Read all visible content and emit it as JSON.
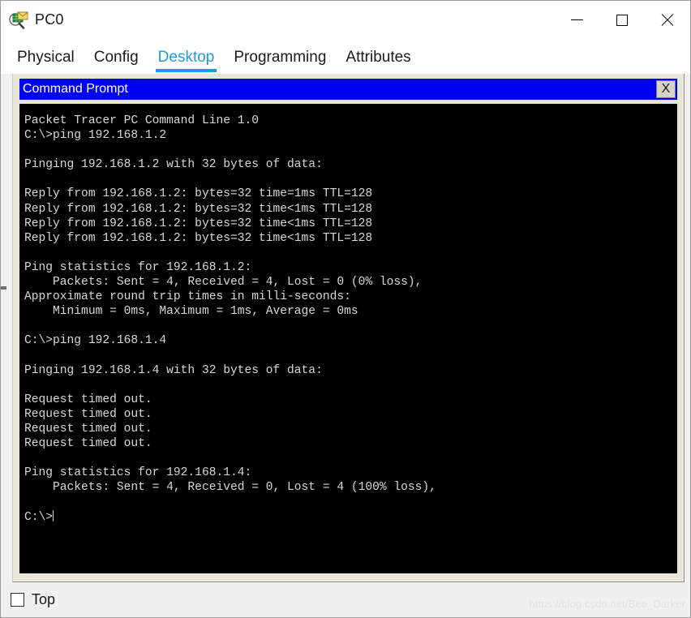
{
  "window": {
    "title": "PC0",
    "icon": "pc-magnifier-envelope-icon",
    "controls": {
      "minimize": "minimize-icon",
      "maximize": "maximize-icon",
      "close": "close-icon"
    }
  },
  "tabs": [
    {
      "label": "Physical",
      "active": false
    },
    {
      "label": "Config",
      "active": false
    },
    {
      "label": "Desktop",
      "active": true
    },
    {
      "label": "Programming",
      "active": false
    },
    {
      "label": "Attributes",
      "active": false
    }
  ],
  "colors": {
    "accent": "#1e9bd7",
    "cmd_titlebar": "#0000f0",
    "panel": "#e8e6d6",
    "terminal_bg": "#000000",
    "terminal_fg": "#d8d8d8"
  },
  "command_prompt": {
    "title": "Command Prompt",
    "close_label": "X",
    "lines": [
      "Packet Tracer PC Command Line 1.0",
      "C:\\>ping 192.168.1.2",
      "",
      "Pinging 192.168.1.2 with 32 bytes of data:",
      "",
      "Reply from 192.168.1.2: bytes=32 time=1ms TTL=128",
      "Reply from 192.168.1.2: bytes=32 time<1ms TTL=128",
      "Reply from 192.168.1.2: bytes=32 time<1ms TTL=128",
      "Reply from 192.168.1.2: bytes=32 time<1ms TTL=128",
      "",
      "Ping statistics for 192.168.1.2:",
      "    Packets: Sent = 4, Received = 4, Lost = 0 (0% loss),",
      "Approximate round trip times in milli-seconds:",
      "    Minimum = 0ms, Maximum = 1ms, Average = 0ms",
      "",
      "C:\\>ping 192.168.1.4",
      "",
      "Pinging 192.168.1.4 with 32 bytes of data:",
      "",
      "Request timed out.",
      "Request timed out.",
      "Request timed out.",
      "Request timed out.",
      "",
      "Ping statistics for 192.168.1.4:",
      "    Packets: Sent = 4, Received = 0, Lost = 4 (100% loss),",
      "",
      "C:\\>"
    ],
    "prompt_text": "C:\\>"
  },
  "bottom": {
    "top_checkbox_label": "Top",
    "top_checkbox_checked": false,
    "watermark": "https://blog.csdn.net/Bee_Darker"
  }
}
